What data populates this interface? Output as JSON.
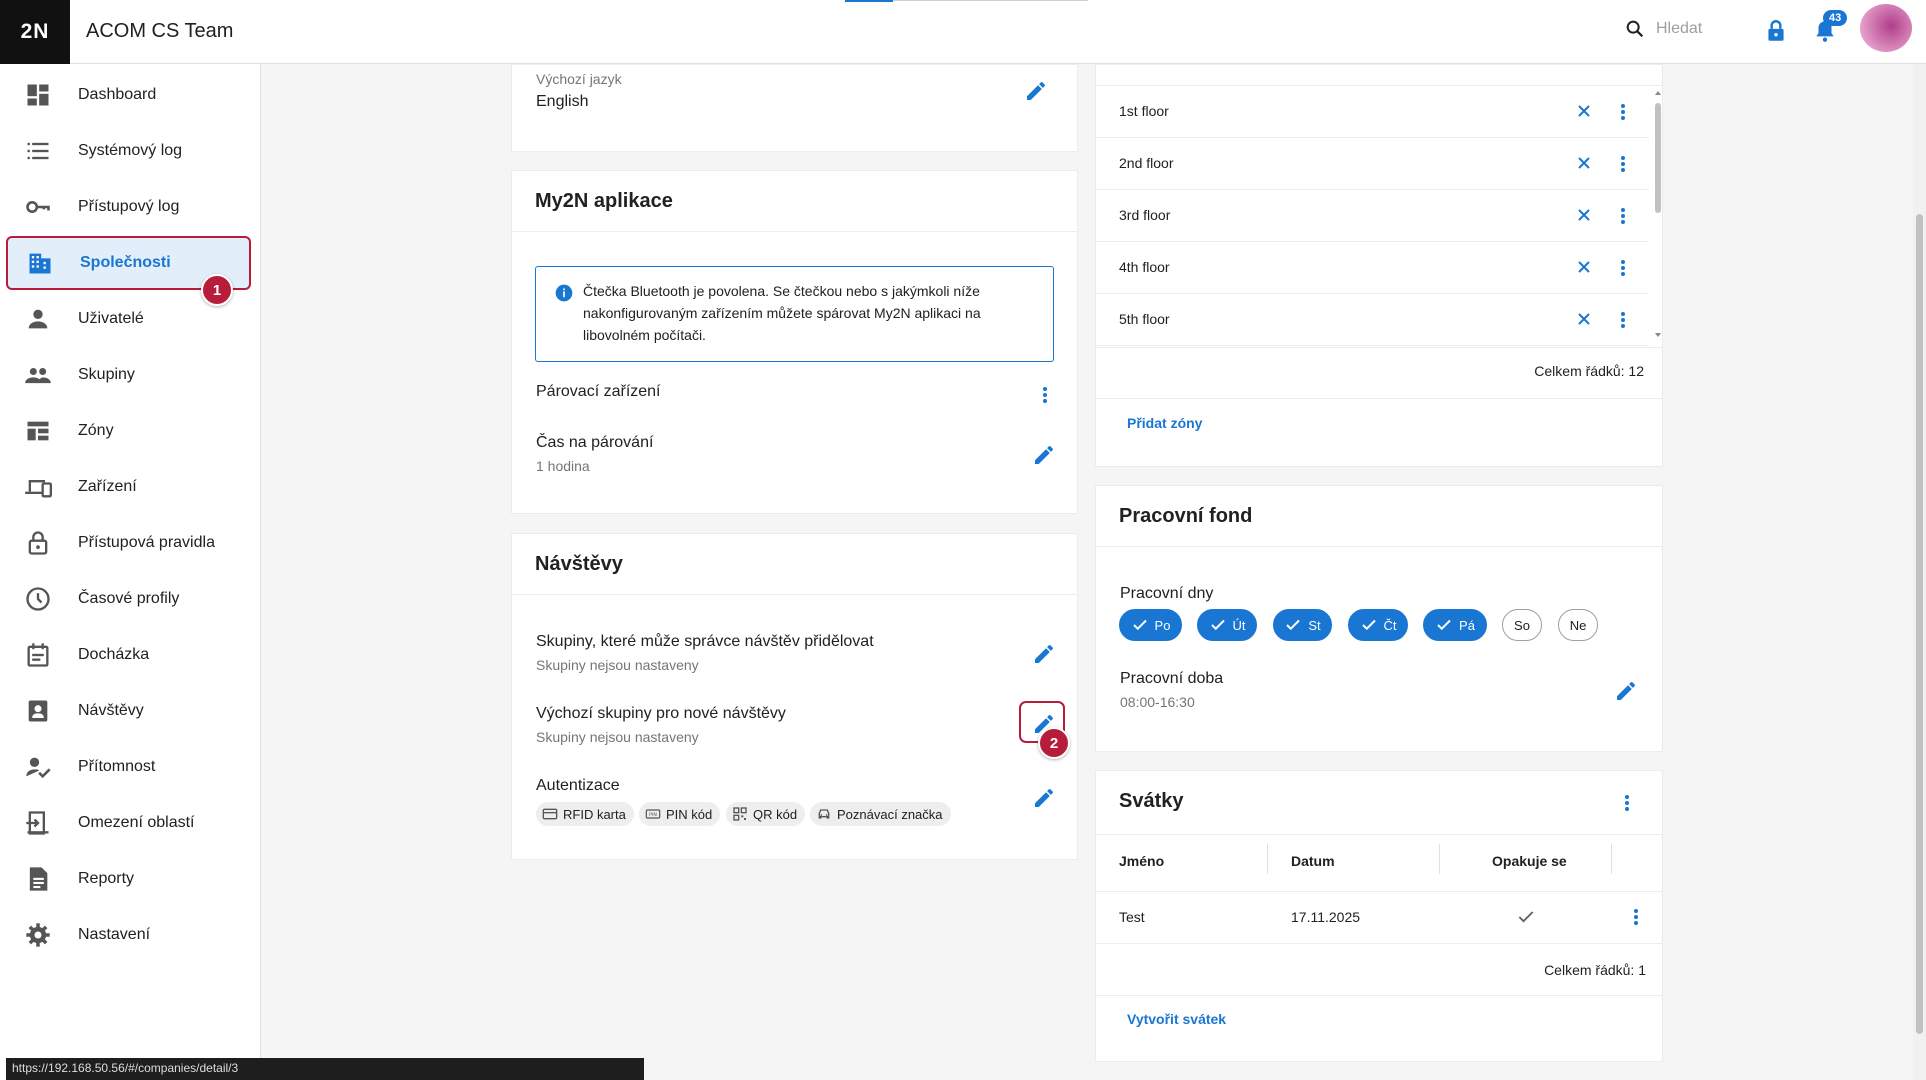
{
  "app": {
    "logo": "2N",
    "title": "ACOM CS Team",
    "search_placeholder": "Hledat",
    "notification_count": "43"
  },
  "sidebar": {
    "items": [
      {
        "label": "Dashboard",
        "icon": "dashboard-icon"
      },
      {
        "label": "Systémový log",
        "icon": "list-icon"
      },
      {
        "label": "Přístupový log",
        "icon": "key-icon"
      },
      {
        "label": "Společnosti",
        "icon": "building-icon",
        "active": true
      },
      {
        "label": "Uživatelé",
        "icon": "person-icon"
      },
      {
        "label": "Skupiny",
        "icon": "group-icon"
      },
      {
        "label": "Zóny",
        "icon": "zones-icon"
      },
      {
        "label": "Zařízení",
        "icon": "devices-icon"
      },
      {
        "label": "Přístupová pravidla",
        "icon": "lock-icon"
      },
      {
        "label": "Časové profily",
        "icon": "clock-icon"
      },
      {
        "label": "Docházka",
        "icon": "calendar-icon"
      },
      {
        "label": "Návštěvy",
        "icon": "visitor-badge-icon"
      },
      {
        "label": "Přítomnost",
        "icon": "person-check-icon"
      },
      {
        "label": "Omezení oblastí",
        "icon": "area-limit-icon"
      },
      {
        "label": "Reporty",
        "icon": "report-icon"
      },
      {
        "label": "Nastavení",
        "icon": "gear-icon"
      }
    ],
    "step_badge": "1"
  },
  "language": {
    "label": "Výchozí jazyk",
    "value": "English"
  },
  "my2n": {
    "title": "My2N aplikace",
    "info": "Čtečka Bluetooth je povolena. Se čtečkou nebo s jakýmkoli níže nakonfigurovaným zařízením můžete spárovat My2N aplikaci na libovolném počítači.",
    "pairing_devices": "Párovací zařízení",
    "pairing_time_label": "Čas na párování",
    "pairing_time_value": "1 hodina"
  },
  "visits": {
    "title": "Návštěvy",
    "groups_label": "Skupiny, které může správce návštěv přidělovat",
    "groups_value": "Skupiny nejsou nastaveny",
    "default_groups_label": "Výchozí skupiny pro nové návštěvy",
    "default_groups_value": "Skupiny nejsou nastaveny",
    "auth_label": "Autentizace",
    "auth_chips": [
      "RFID karta",
      "PIN kód",
      "QR kód",
      "Poznávací značka"
    ],
    "step_badge": "2"
  },
  "zones": {
    "rows": [
      "1st floor",
      "2nd floor",
      "3rd floor",
      "4th floor",
      "5th floor"
    ],
    "total": "Celkem řádků: 12",
    "add_link": "Přidat zóny"
  },
  "workfund": {
    "title": "Pracovní fond",
    "days_label": "Pracovní dny",
    "days": [
      {
        "label": "Po",
        "on": true
      },
      {
        "label": "Út",
        "on": true
      },
      {
        "label": "St",
        "on": true
      },
      {
        "label": "Čt",
        "on": true
      },
      {
        "label": "Pá",
        "on": true
      },
      {
        "label": "So",
        "on": false
      },
      {
        "label": "Ne",
        "on": false
      }
    ],
    "hours_label": "Pracovní doba",
    "hours_value": "08:00-16:30"
  },
  "holidays": {
    "title": "Svátky",
    "columns": [
      "Jméno",
      "Datum",
      "Opakuje se"
    ],
    "rows": [
      {
        "name": "Test",
        "date": "17.11.2025",
        "repeats": true
      }
    ],
    "total": "Celkem řádků: 1",
    "create_link": "Vytvořit svátek"
  },
  "statusbar": {
    "url": "https://192.168.50.56/#/companies/detail/3"
  },
  "colors": {
    "accent": "#1976d2",
    "highlight": "#b71c3a"
  }
}
